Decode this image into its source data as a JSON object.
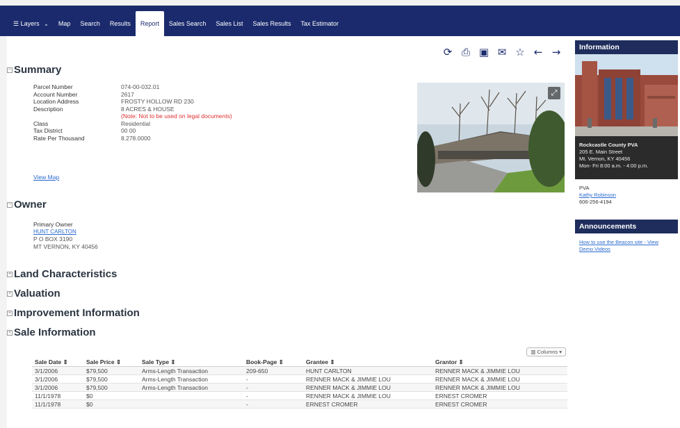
{
  "nav": {
    "items": [
      {
        "label": "Layers",
        "icon": "layers-icon",
        "dropdown": true
      },
      {
        "label": "Map"
      },
      {
        "label": "Search"
      },
      {
        "label": "Results"
      },
      {
        "label": "Report",
        "active": true
      },
      {
        "label": "Sales Search"
      },
      {
        "label": "Sales List"
      },
      {
        "label": "Sales Results"
      },
      {
        "label": "Tax Estimator"
      }
    ],
    "layers_icon_glyph": "☰",
    "caret_glyph": "⌄"
  },
  "toolbar": {
    "icons": [
      {
        "name": "share-icon",
        "glyph": "⟳"
      },
      {
        "name": "print-icon",
        "glyph": "⎙"
      },
      {
        "name": "image-icon",
        "glyph": "▣"
      },
      {
        "name": "email-icon",
        "glyph": "✉"
      },
      {
        "name": "star-icon",
        "glyph": "☆"
      },
      {
        "name": "back-arrow-icon",
        "glyph": "←"
      },
      {
        "name": "forward-arrow-icon",
        "glyph": "→"
      }
    ]
  },
  "summary": {
    "title": "Summary",
    "toggle": "−",
    "labels": {
      "parcel": "Parcel Number",
      "account": "Account Number",
      "location": "Location Address",
      "description": "Description",
      "class": "Class",
      "tax_district": "Tax District",
      "rate": "Rate Per Thousand"
    },
    "values": {
      "parcel": "074-00-032.01",
      "account": "2617",
      "location": "FROSTY HOLLOW RD 230",
      "description": "8 ACRES & HOUSE",
      "note": "(Note: Not to be used on legal documents)",
      "class": "Residential",
      "tax_district": "00 00",
      "rate": "8.278.0000"
    },
    "view_map": "View Map"
  },
  "owner": {
    "title": "Owner",
    "toggle": "−",
    "primary_label": "Primary Owner",
    "name": "HUNT CARLTON",
    "address1": "P O BOX 3190",
    "address2": "MT VERNON, KY 40456"
  },
  "sections": {
    "land": "Land Characteristics",
    "valuation": "Valuation",
    "improvement": "Improvement Information",
    "sale": "Sale Information",
    "toggle": "+"
  },
  "sales_table": {
    "columns_button": "▥ Columns ▾",
    "headers": [
      "Sale Date ⇕",
      "Sale Price ⇕",
      "Sale Type ⇕",
      "Book-Page ⇕",
      "Grantee ⇕",
      "Grantor ⇕"
    ],
    "rows": [
      [
        "3/1/2006",
        "$79,500",
        "Arms-Length Transaction",
        "209-650",
        "HUNT CARLTON",
        "RENNER MACK & JIMMIE LOU"
      ],
      [
        "3/1/2006",
        "$79,500",
        "Arms-Length Transaction",
        "-",
        "RENNER MACK & JIMMIE LOU",
        "RENNER MACK & JIMMIE LOU"
      ],
      [
        "3/1/2006",
        "$79,500",
        "Arms-Length Transaction",
        "-",
        "RENNER MACK & JIMMIE LOU",
        "RENNER MACK & JIMMIE LOU"
      ],
      [
        "11/1/1978",
        "$0",
        "",
        "-",
        "RENNER MACK & JIMMIE LOU",
        "ERNEST CROMER"
      ],
      [
        "11/1/1978",
        "$0",
        "",
        "-",
        "ERNEST CROMER",
        "ERNEST CROMER"
      ]
    ]
  },
  "sidebar": {
    "info_title": "Information",
    "office_name": "Rockcastle County PVA",
    "office_street": "205 E. Main Street",
    "office_city": "Mt. Vernon, KY 40456",
    "office_hours": "Mon- Fri 8:00 a.m. - 4:00 p.m.",
    "pva_label": "PVA",
    "pva_name": "Kathy Robinson",
    "pva_phone": "606-256-4194",
    "ann_title": "Announcements",
    "ann_link": "How to use the Beacon site - View Demo Videos"
  },
  "colors": {
    "nav_bg": "#1a2a6c",
    "sidebar_header": "#1e2d5c",
    "link": "#2a6ad0",
    "note_red": "#e03030"
  }
}
